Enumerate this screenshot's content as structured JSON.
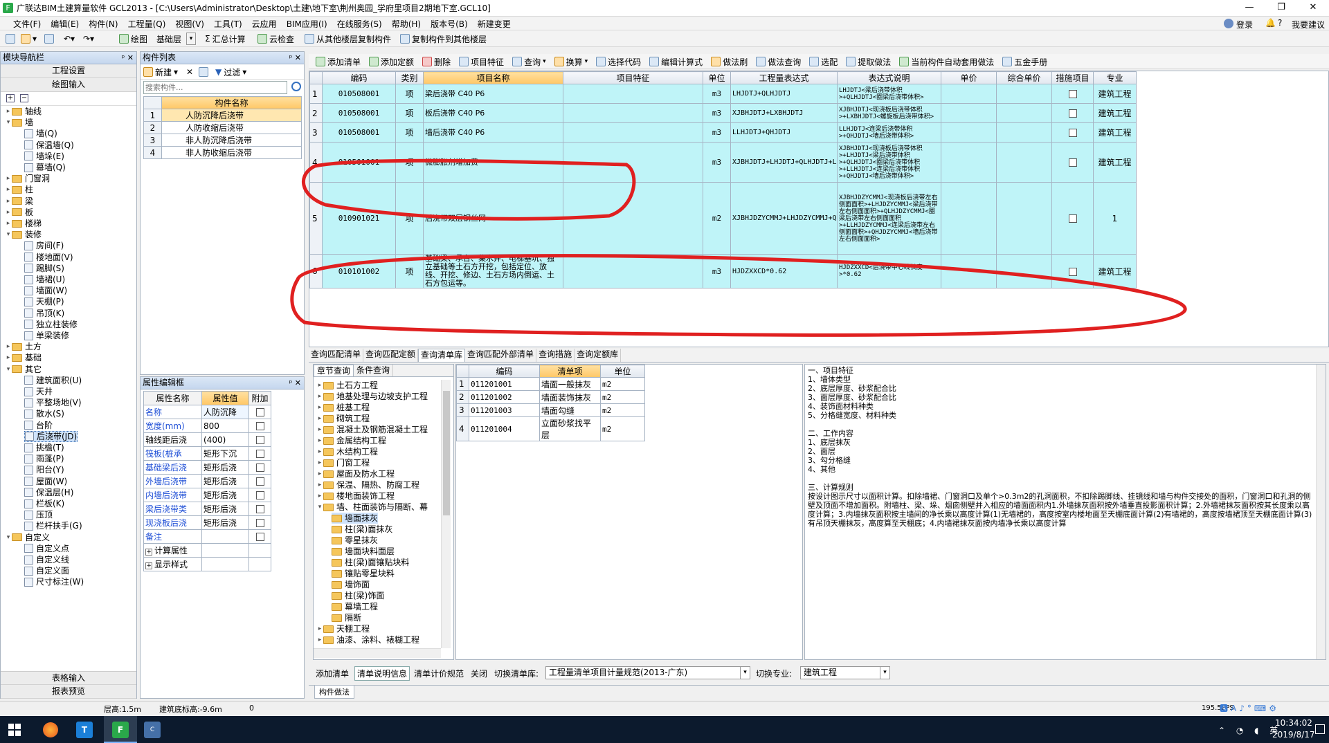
{
  "window": {
    "title": "广联达BIM土建算量软件 GCL2013 - [C:\\Users\\Administrator\\Desktop\\土建\\地下室\\荆州奥园_学府里项目2期地下室.GCL10]"
  },
  "menu": [
    "文件(F)",
    "编辑(E)",
    "构件(N)",
    "工程量(Q)",
    "视图(V)",
    "工具(T)",
    "云应用",
    "BIM应用(I)",
    "在线服务(S)",
    "帮助(H)",
    "版本号(B)",
    "新建变更"
  ],
  "account": {
    "login": "登录",
    "suggest": "我要建议"
  },
  "toolbar1": {
    "draw": "绘图",
    "layer": "基础层",
    "sum": "汇总计算",
    "cloud": "云检查",
    "copy_from": "从其他楼层复制构件",
    "copy_to": "复制构件到其他楼层"
  },
  "toolbar2": [
    "添加清单",
    "添加定额",
    "删除",
    "项目特征",
    "查询",
    "换算",
    "选择代码",
    "编辑计算式",
    "做法刷",
    "做法查询",
    "选配",
    "提取做法",
    "当前构件自动套用做法",
    "五金手册"
  ],
  "nav": {
    "title": "模块导航栏",
    "project_settings": "工程设置",
    "drawing_input": "绘图输入",
    "table_input": "表格输入",
    "report_preview": "报表预览",
    "tree": [
      {
        "label": "轴线",
        "level": 0,
        "type": "folder",
        "expand": "+"
      },
      {
        "label": "墙",
        "level": 0,
        "type": "folder",
        "expand": "-"
      },
      {
        "label": "墙(Q)",
        "level": 1,
        "type": "doc"
      },
      {
        "label": "保温墙(Q)",
        "level": 1,
        "type": "doc"
      },
      {
        "label": "墙垛(E)",
        "level": 1,
        "type": "doc"
      },
      {
        "label": "幕墙(Q)",
        "level": 1,
        "type": "doc"
      },
      {
        "label": "门窗洞",
        "level": 0,
        "type": "folder",
        "expand": "+"
      },
      {
        "label": "柱",
        "level": 0,
        "type": "folder",
        "expand": "+"
      },
      {
        "label": "梁",
        "level": 0,
        "type": "folder",
        "expand": "+"
      },
      {
        "label": "板",
        "level": 0,
        "type": "folder",
        "expand": "+"
      },
      {
        "label": "楼梯",
        "level": 0,
        "type": "folder",
        "expand": "+"
      },
      {
        "label": "装修",
        "level": 0,
        "type": "folder",
        "expand": "-"
      },
      {
        "label": "房间(F)",
        "level": 1,
        "type": "doc"
      },
      {
        "label": "楼地面(V)",
        "level": 1,
        "type": "doc"
      },
      {
        "label": "踢脚(S)",
        "level": 1,
        "type": "doc"
      },
      {
        "label": "墙裙(U)",
        "level": 1,
        "type": "doc"
      },
      {
        "label": "墙面(W)",
        "level": 1,
        "type": "doc"
      },
      {
        "label": "天棚(P)",
        "level": 1,
        "type": "doc"
      },
      {
        "label": "吊顶(K)",
        "level": 1,
        "type": "doc"
      },
      {
        "label": "独立柱装修",
        "level": 1,
        "type": "doc"
      },
      {
        "label": "单梁装修",
        "level": 1,
        "type": "doc"
      },
      {
        "label": "土方",
        "level": 0,
        "type": "folder",
        "expand": "+"
      },
      {
        "label": "基础",
        "level": 0,
        "type": "folder",
        "expand": "+"
      },
      {
        "label": "其它",
        "level": 0,
        "type": "folder",
        "expand": "-"
      },
      {
        "label": "建筑面积(U)",
        "level": 1,
        "type": "doc"
      },
      {
        "label": "天井",
        "level": 1,
        "type": "doc"
      },
      {
        "label": "平整场地(V)",
        "level": 1,
        "type": "doc"
      },
      {
        "label": "散水(S)",
        "level": 1,
        "type": "doc"
      },
      {
        "label": "台阶",
        "level": 1,
        "type": "doc"
      },
      {
        "label": "后浇带(JD)",
        "level": 1,
        "type": "doc",
        "selected": true
      },
      {
        "label": "挑檐(T)",
        "level": 1,
        "type": "doc"
      },
      {
        "label": "雨蓬(P)",
        "level": 1,
        "type": "doc"
      },
      {
        "label": "阳台(Y)",
        "level": 1,
        "type": "doc"
      },
      {
        "label": "屋面(W)",
        "level": 1,
        "type": "doc"
      },
      {
        "label": "保温层(H)",
        "level": 1,
        "type": "doc"
      },
      {
        "label": "栏板(K)",
        "level": 1,
        "type": "doc"
      },
      {
        "label": "压顶",
        "level": 1,
        "type": "doc"
      },
      {
        "label": "栏杆扶手(G)",
        "level": 1,
        "type": "doc"
      },
      {
        "label": "自定义",
        "level": 0,
        "type": "folder",
        "expand": "-"
      },
      {
        "label": "自定义点",
        "level": 1,
        "type": "doc"
      },
      {
        "label": "自定义线",
        "level": 1,
        "type": "doc"
      },
      {
        "label": "自定义面",
        "level": 1,
        "type": "doc"
      },
      {
        "label": "尺寸标注(W)",
        "level": 1,
        "type": "doc"
      }
    ]
  },
  "components": {
    "title": "构件列表",
    "new": "新建",
    "filter": "过滤",
    "search_placeholder": "搜索构件...",
    "header": "构件名称",
    "rows": [
      {
        "no": "1",
        "name": "人防沉降后浇带"
      },
      {
        "no": "2",
        "name": "人防收缩后浇带"
      },
      {
        "no": "3",
        "name": "非人防沉降后浇带"
      },
      {
        "no": "4",
        "name": "非人防收缩后浇带"
      }
    ]
  },
  "props": {
    "title": "属性编辑框",
    "headers": [
      "属性名称",
      "属性值",
      "附加"
    ],
    "rows": [
      {
        "name": "名称",
        "value": "人防沉降",
        "check": false,
        "blue": true
      },
      {
        "name": "宽度(mm)",
        "value": "800",
        "check": true,
        "blue": true
      },
      {
        "name": "轴线距后浇",
        "value": "(400)",
        "check": true,
        "blue": false
      },
      {
        "name": "筏板(桩承",
        "value": "矩形下沉",
        "check": true,
        "blue": true
      },
      {
        "name": "基础梁后浇",
        "value": "矩形后浇",
        "check": true,
        "blue": true
      },
      {
        "name": "外墙后浇带",
        "value": "矩形后浇",
        "check": true,
        "blue": true
      },
      {
        "name": "内墙后浇带",
        "value": "矩形后浇",
        "check": true,
        "blue": true
      },
      {
        "name": "梁后浇带类",
        "value": "矩形后浇",
        "check": true,
        "blue": true
      },
      {
        "name": "现浇板后浇",
        "value": "矩形后浇",
        "check": true,
        "blue": true
      },
      {
        "name": "备注",
        "value": "",
        "check": true,
        "blue": true
      },
      {
        "name": "计算属性",
        "value": "",
        "check": null,
        "blue": false,
        "group": true
      },
      {
        "name": "显示样式",
        "value": "",
        "check": null,
        "blue": false,
        "group": true
      }
    ]
  },
  "main_grid": {
    "headers": [
      "",
      "编码",
      "类别",
      "项目名称",
      "项目特征",
      "单位",
      "工程量表达式",
      "表达式说明",
      "单价",
      "综合单价",
      "措施项目",
      "专业"
    ],
    "rows": [
      {
        "no": "1",
        "code": "010508001",
        "type": "项",
        "name": "梁后浇带 C40 P6",
        "feature": "",
        "unit": "m3",
        "expr": "LHJDTJ+QLHJDTJ",
        "desc": "LHJDTJ<梁后浇带体积>+QLHJDTJ<圈梁后浇带体积>",
        "price": "",
        "total": "",
        "measure": false,
        "major": "建筑工程"
      },
      {
        "no": "2",
        "code": "010508001",
        "type": "项",
        "name": "板后浇带 C40 P6",
        "feature": "",
        "unit": "m3",
        "expr": "XJBHJDTJ+LXBHJDTJ",
        "desc": "XJBHJDTJ<现浇板后浇带体积>+LXBHJDTJ<螺旋板后浇带体积>",
        "price": "",
        "total": "",
        "measure": false,
        "major": "建筑工程"
      },
      {
        "no": "3",
        "code": "010508001",
        "type": "项",
        "name": "墙后浇带 C40 P6",
        "feature": "",
        "unit": "m3",
        "expr": "LLHJDTJ+QHJDTJ",
        "desc": "LLHJDTJ<连梁后浇带体积>+QHJDTJ<墙后浇带体积>",
        "price": "",
        "total": "",
        "measure": false,
        "major": "建筑工程"
      },
      {
        "no": "4",
        "code": "010501001",
        "type": "项",
        "name": "微膨胀剂增加费",
        "feature": "",
        "unit": "m3",
        "expr": "XJBHJDTJ+LHJDTJ+QLHJDTJ+LLHJDTJ+QHJDTJ",
        "desc": "XJBHJDTJ<现浇板后浇带体积>+LHJDTJ<梁后浇带体积>+QLHJDTJ<圈梁后浇带体积>+LLHJDTJ<连梁后浇带体积>+QHJDTJ<墙后浇带体积>",
        "price": "",
        "total": "",
        "measure": false,
        "major": "建筑工程"
      },
      {
        "no": "5",
        "code": "010901021",
        "type": "项",
        "name": "后浇带双层钢丝网",
        "feature": "",
        "unit": "m2",
        "expr": "XJBHJDZYCMMJ+LHJDZYCMMJ+QLHJDZYCMMJ+LLHJDZYCMMJ+QHJDZYCMMJ",
        "desc": "XJBHJDZYCMMJ<现浇板后浇带左右侧面面积>+LHJDZYCMMJ<梁后浇带左右侧面面积>+QLHJDZYCMMJ<圈梁后浇带左右侧面面积>+LLHJDZYCMMJ<连梁后浇带左右侧面面积>+QHJDZYCMMJ<墙后浇带左右侧面面积>",
        "price": "",
        "total": "",
        "measure": false,
        "major": "1"
      },
      {
        "no": "6",
        "code": "010101002",
        "type": "项",
        "name": "基础梁、承台、集水井、电梯基坑、独立基础等土石方开挖，包括定位、放线、开挖、修边、土石方场内倒运、土石方包运等。",
        "feature": "",
        "unit": "m3",
        "expr": "HJDZXXCD*0.62",
        "desc": "HJDZXXCD<后浇带中心线长度>*0.62",
        "price": "",
        "total": "",
        "measure": false,
        "major": "建筑工程"
      }
    ]
  },
  "query_tabs": [
    "查询匹配清单",
    "查询匹配定额",
    "查询清单库",
    "查询匹配外部清单",
    "查询措施",
    "查询定额库"
  ],
  "query_active": 2,
  "sub_tabs": [
    "章节查询",
    "条件查询"
  ],
  "chapter_tree": [
    {
      "label": "土石方工程",
      "level": 0,
      "expand": "+"
    },
    {
      "label": "地基处理与边坡支护工程",
      "level": 0,
      "expand": "+"
    },
    {
      "label": "桩基工程",
      "level": 0,
      "expand": "+"
    },
    {
      "label": "砌筑工程",
      "level": 0,
      "expand": "+"
    },
    {
      "label": "混凝土及钢筋混凝土工程",
      "level": 0,
      "expand": "+"
    },
    {
      "label": "金属结构工程",
      "level": 0,
      "expand": "+"
    },
    {
      "label": "木结构工程",
      "level": 0,
      "expand": "+"
    },
    {
      "label": "门窗工程",
      "level": 0,
      "expand": "+"
    },
    {
      "label": "屋面及防水工程",
      "level": 0,
      "expand": "+"
    },
    {
      "label": "保温、隔热、防腐工程",
      "level": 0,
      "expand": "+"
    },
    {
      "label": "楼地面装饰工程",
      "level": 0,
      "expand": "+"
    },
    {
      "label": "墙、柱面装饰与隔断、幕",
      "level": 0,
      "expand": "-"
    },
    {
      "label": "墙面抹灰",
      "level": 1,
      "selected": true
    },
    {
      "label": "柱(梁)面抹灰",
      "level": 1
    },
    {
      "label": "零星抹灰",
      "level": 1
    },
    {
      "label": "墙面块料面层",
      "level": 1
    },
    {
      "label": "柱(梁)面镶贴块料",
      "level": 1
    },
    {
      "label": "镶贴零星块料",
      "level": 1
    },
    {
      "label": "墙饰面",
      "level": 1
    },
    {
      "label": "柱(梁)饰面",
      "level": 1
    },
    {
      "label": "幕墙工程",
      "level": 1
    },
    {
      "label": "隔断",
      "level": 1
    },
    {
      "label": "天棚工程",
      "level": 0,
      "expand": "+"
    },
    {
      "label": "油漆、涂料、裱糊工程",
      "level": 0,
      "expand": "+"
    }
  ],
  "list_grid": {
    "headers": [
      "",
      "编码",
      "清单项",
      "单位"
    ],
    "rows": [
      {
        "no": "1",
        "code": "011201001",
        "name": "墙面一般抹灰",
        "unit": "m2"
      },
      {
        "no": "2",
        "code": "011201002",
        "name": "墙面装饰抹灰",
        "unit": "m2"
      },
      {
        "no": "3",
        "code": "011201003",
        "name": "墙面勾缝",
        "unit": "m2"
      },
      {
        "no": "4",
        "code": "011201004",
        "name": "立面砂浆找平层",
        "unit": "m2"
      }
    ]
  },
  "description": [
    "一、项目特征",
    "1、墙体类型",
    "2、底层厚度、砂浆配合比",
    "3、面层厚度、砂浆配合比",
    "4、装饰面材料种类",
    "5、分格缝宽度、材料种类",
    "",
    "二、工作内容",
    "1、底层抹灰",
    "2、面层",
    "3、勾分格缝",
    "4、其他",
    "",
    "三、计算规则",
    " 按设计图示尺寸以面积计算。扣除墙裙、门窗洞口及单个>0.3m2的孔洞面积，不扣除踢脚线、挂镜线和墙与构件交接处的面积，门窗洞口和孔洞的侧壁及顶面不增加面积。附墙柱、梁、垛、烟囱侧壁并入相应的墙面面积内1.外墙抹灰面积按外墙垂直投影面积计算；2.外墙裙抹灰面积按其长度乘以高度计算；3.内墙抹灰面积按主墙间的净长乘以高度计算(1)无墙裙的，高度按室内楼地面至天棚底面计算(2)有墙裙的，高度按墙裙顶至天棚底面计算(3)有吊顶天棚抹灰，高度算至天棚底；4.内墙裙抹灰面按内墙净长乘以高度计算"
  ],
  "bottom_bar": {
    "add": "添加清单",
    "info": "清单说明信息",
    "rule": "清单计价规范",
    "close": "关闭",
    "switch_lib": "切换清单库:",
    "lib_value": "工程量清单项目计量规范(2013-广东)",
    "switch_major": "切换专业:",
    "major_value": "建筑工程"
  },
  "method_tab": "构件做法",
  "status": {
    "floor_height": "层高:1.5m",
    "base_elev": "建筑底标高:-9.6m",
    "zero": "0",
    "fps": "195.5FPS"
  },
  "taskbar": {
    "time": "10:34:02",
    "date": "2019/8/17"
  }
}
